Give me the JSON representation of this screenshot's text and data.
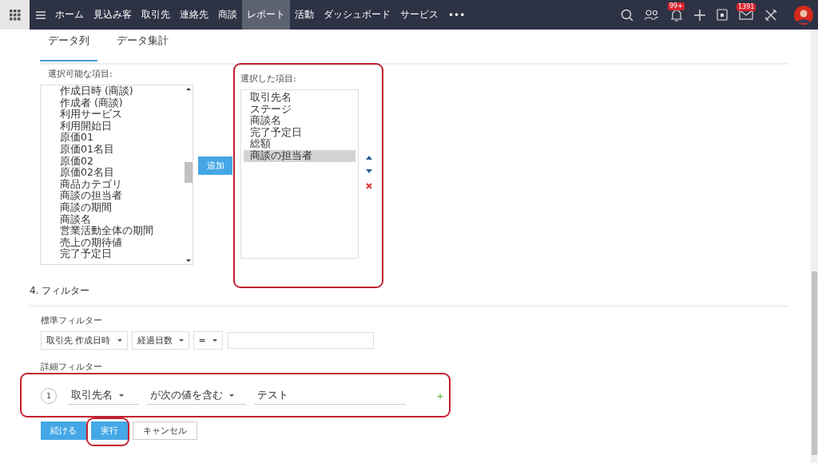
{
  "nav": {
    "items": [
      {
        "label": "ホーム",
        "selected": false
      },
      {
        "label": "見込み客",
        "selected": false
      },
      {
        "label": "取引先",
        "selected": false
      },
      {
        "label": "連絡先",
        "selected": false
      },
      {
        "label": "商談",
        "selected": false
      },
      {
        "label": "レポート",
        "selected": true
      },
      {
        "label": "活動",
        "selected": false
      },
      {
        "label": "ダッシュボード",
        "selected": false
      },
      {
        "label": "サービス",
        "selected": false
      }
    ],
    "more": "•••",
    "notifications_badge": "99+",
    "mail_badge": "1391"
  },
  "tabs": [
    {
      "label": "データ列",
      "selected": true
    },
    {
      "label": "データ集計",
      "selected": false
    }
  ],
  "available": {
    "label": "選択可能な項目:",
    "items": [
      "作成日時 (商談)",
      "作成者 (商談)",
      "利用サービス",
      "利用開始日",
      "原価01",
      "原価01名目",
      "原価02",
      "原価02名目",
      "商品カテゴリ",
      "商談の担当者",
      "商談の期間",
      "商談名",
      "営業活動全体の期間",
      "売上の期待値",
      "完了予定日"
    ]
  },
  "add_button": "追加",
  "selected_columns": {
    "label": "選択した項目:",
    "items": [
      {
        "label": "取引先名",
        "selected": false
      },
      {
        "label": "ステージ",
        "selected": false
      },
      {
        "label": "商談名",
        "selected": false
      },
      {
        "label": "完了予定日",
        "selected": false
      },
      {
        "label": "総額",
        "selected": false
      },
      {
        "label": "商談の担当者",
        "selected": true
      }
    ]
  },
  "filter": {
    "heading": "4. フィルター",
    "standard_label": "標準フィルター",
    "standard": {
      "field": "取引先 作成日時",
      "period": "経過日数",
      "operator": "="
    },
    "advanced_label": "詳細フィルター",
    "advanced": {
      "number": "1",
      "field": "取引先名",
      "condition": "が次の値を含む",
      "value": "テスト",
      "add": "+"
    }
  },
  "buttons": {
    "continue": "続ける",
    "run": "実行",
    "cancel": "キャンセル"
  }
}
